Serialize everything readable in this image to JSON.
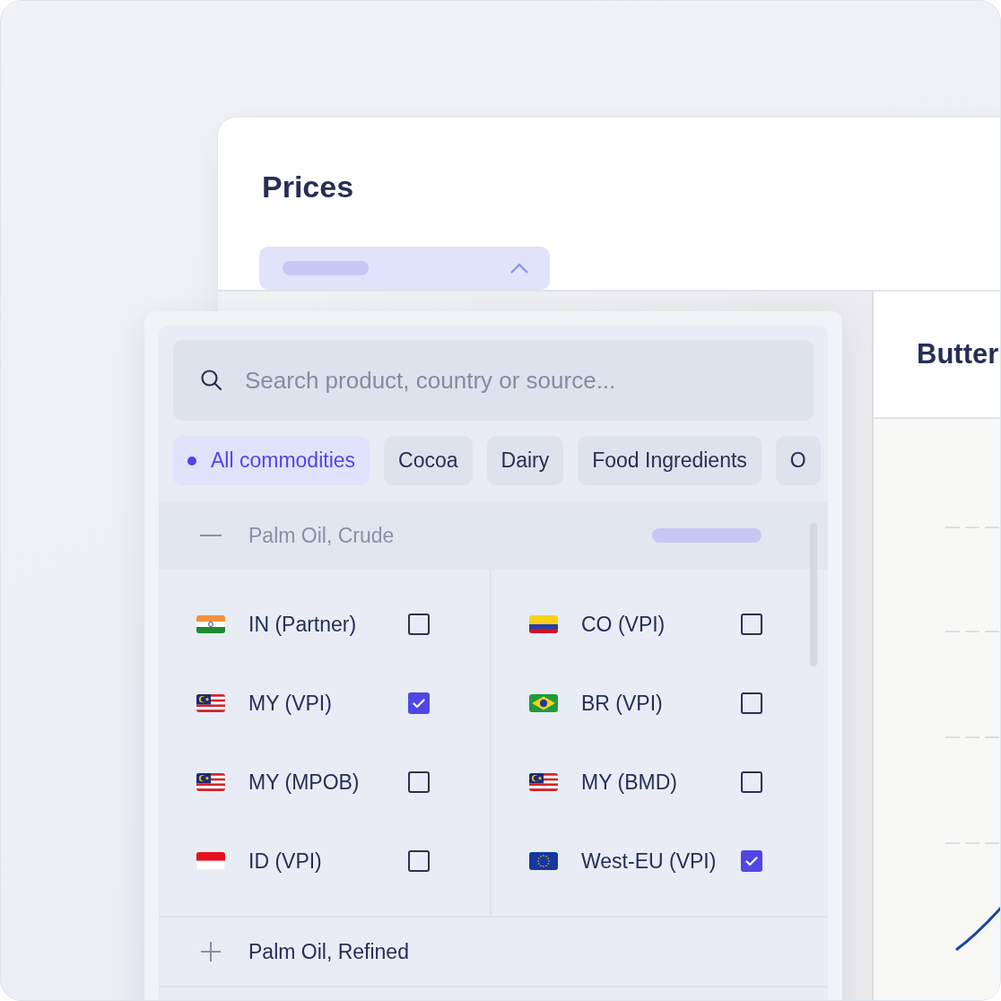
{
  "card": {
    "title": "Prices",
    "column_header": "Butter"
  },
  "dropdown": {
    "search": {
      "placeholder": "Search product, country or source..."
    },
    "chips": [
      {
        "label": "All commodities",
        "selected": true
      },
      {
        "label": "Cocoa",
        "selected": false
      },
      {
        "label": "Dairy",
        "selected": false
      },
      {
        "label": "Food Ingredients",
        "selected": false
      },
      {
        "label": "O",
        "selected": false
      }
    ],
    "groups": [
      {
        "name": "Palm Oil, Crude",
        "expanded": true,
        "columns": [
          [
            {
              "label": "IN (Partner)",
              "kind": "india",
              "checked": false
            },
            {
              "label": "MY (VPI)",
              "kind": "malaysia",
              "checked": true
            },
            {
              "label": "MY (MPOB)",
              "kind": "malaysia",
              "checked": false
            },
            {
              "label": "ID (VPI)",
              "kind": "indonesia",
              "checked": false
            }
          ],
          [
            {
              "label": "CO (VPI)",
              "kind": "colombia",
              "checked": false
            },
            {
              "label": "BR (VPI)",
              "kind": "brazil",
              "checked": false
            },
            {
              "label": "MY (BMD)",
              "kind": "malaysia",
              "checked": false
            },
            {
              "label": "West-EU (VPI)",
              "kind": "eu",
              "checked": true
            }
          ]
        ]
      },
      {
        "name": "Palm Oil, Refined",
        "expanded": false
      }
    ]
  }
}
